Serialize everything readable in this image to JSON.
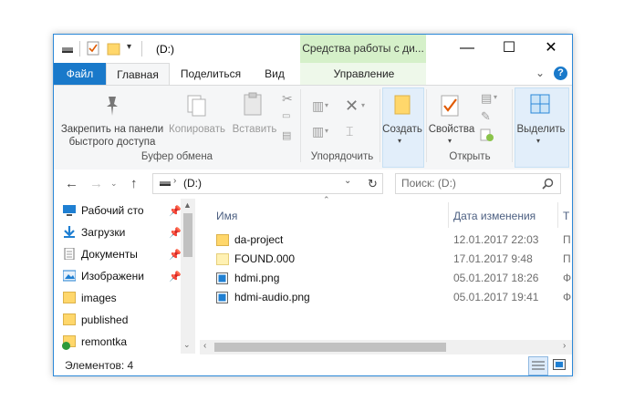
{
  "window": {
    "title": "(D:)",
    "context_group_title": "Средства работы с ди...",
    "controls": {
      "minimize": "—",
      "maximize": "☐",
      "close": "✕"
    }
  },
  "tabs": [
    {
      "label": "Файл"
    },
    {
      "label": "Главная"
    },
    {
      "label": "Поделиться"
    },
    {
      "label": "Вид"
    },
    {
      "label": "Управление"
    }
  ],
  "ribbon": {
    "pin_label": "Закрепить на панели быстрого доступа",
    "copy_label": "Копировать",
    "paste_label": "Вставить",
    "clipboard_group": "Буфер обмена",
    "organize_group": "Упорядочить",
    "create_label": "Создать",
    "properties_label": "Свойства",
    "open_group": "Открыть",
    "select_label": "Выделить"
  },
  "address": {
    "path": "(D:)",
    "search_placeholder": "Поиск: (D:)"
  },
  "nav_pane": {
    "items": [
      {
        "label": "Рабочий сто",
        "icon": "desktop-icon",
        "pinned": true
      },
      {
        "label": "Загрузки",
        "icon": "downloads-icon",
        "pinned": true
      },
      {
        "label": "Документы",
        "icon": "documents-icon",
        "pinned": true
      },
      {
        "label": "Изображени",
        "icon": "pictures-icon",
        "pinned": true
      },
      {
        "label": "images",
        "icon": "folder-icon",
        "pinned": false
      },
      {
        "label": "published",
        "icon": "folder-icon",
        "pinned": false
      },
      {
        "label": "remontka",
        "icon": "folder-sync-icon",
        "pinned": false
      }
    ]
  },
  "file_list": {
    "columns": [
      "Имя",
      "Дата изменения",
      "Т"
    ],
    "rows": [
      {
        "name": "da-project",
        "date": "12.01.2017 22:03",
        "type": "П",
        "icon": "folder-icon"
      },
      {
        "name": "FOUND.000",
        "date": "17.01.2017 9:48",
        "type": "П",
        "icon": "folder-icon"
      },
      {
        "name": "hdmi.png",
        "date": "05.01.2017 18:26",
        "type": "Ф",
        "icon": "image-file-icon"
      },
      {
        "name": "hdmi-audio.png",
        "date": "05.01.2017 19:41",
        "type": "Ф",
        "icon": "image-file-icon"
      }
    ]
  },
  "status": {
    "items_count": "Элементов: 4"
  },
  "colors": {
    "file_tab": "#1979ca",
    "context_tab": "#d5f0c9",
    "selection": "#cce8ff",
    "folder": "#ffd76b"
  }
}
